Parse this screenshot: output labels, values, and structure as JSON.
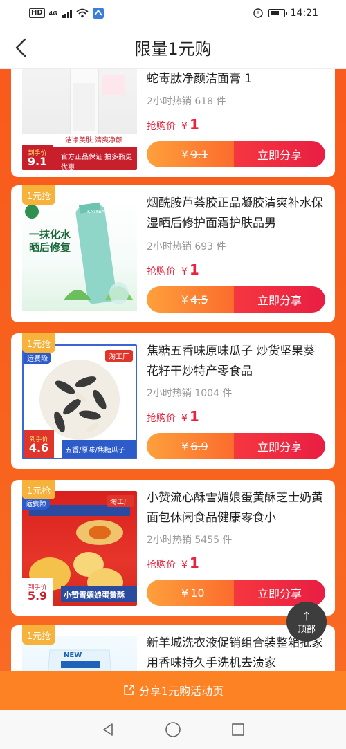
{
  "status_bar": {
    "hd": "HD",
    "network": "4G",
    "time": "14:21"
  },
  "nav": {
    "title": "限量1元购"
  },
  "badge_label": "1元抢",
  "products": [
    {
      "name": "蛇毒肽净颜洁面膏 1",
      "sales": "2小时热销 618 件",
      "price_label": "抢购价",
      "currency": "¥",
      "price": "1",
      "old_price": "9.1",
      "share_label": "立即分享",
      "thumb_text": [
        "洁净美肤 清爽净颜",
        "官方正品保证 拍多瓶更优惠",
        "到手价",
        "9.1"
      ]
    },
    {
      "name": "烟酰胺芦荟胶正品凝胶清爽补水保湿晒后修护面霜护肤品男",
      "sales": "2小时热销 693 件",
      "price_label": "抢购价",
      "currency": "¥",
      "price": "1",
      "old_price": "4.5",
      "share_label": "立即分享",
      "thumb_text": [
        "一抹化水",
        "晒后修复",
        "KNIYEA"
      ]
    },
    {
      "name": "焦糖五香味原味瓜子 炒货坚果葵花籽干炒特产零食品",
      "sales": "2小时热销 1004 件",
      "price_label": "抢购价",
      "currency": "¥",
      "price": "1",
      "old_price": "6.9",
      "share_label": "立即分享",
      "thumb_text": [
        "运费险",
        "淘工厂",
        "五香/原味/焦糖瓜子",
        "到手价",
        "4.6"
      ]
    },
    {
      "name": "小赞流心酥雪媚娘蛋黄酥芝士奶黄面包休闲食品健康零食小",
      "sales": "2小时热销 5455 件",
      "price_label": "抢购价",
      "currency": "¥",
      "price": "1",
      "old_price": "10",
      "share_label": "立即分享",
      "thumb_text": [
        "运费险",
        "淘工厂",
        "小赞雪媚娘蛋黄酥",
        "到手价",
        "5.9"
      ]
    },
    {
      "name": "新羊城洗衣液促销组合装整箱批家用香味持久手洗机去渍家",
      "sales": "",
      "price_label": "",
      "currency": "",
      "price": "",
      "old_price": "",
      "share_label": "",
      "thumb_text": [
        "NEW"
      ]
    }
  ],
  "scroll_top": {
    "label": "顶部"
  },
  "bottom_share": {
    "label": "分享1元购活动页"
  },
  "colors": {
    "bg_orange": "#f95a1d",
    "price_red": "#e8233f",
    "badge_yellow": "#f6b23a",
    "share_red": "#e81e43",
    "bottom_bar": "#fd8224"
  }
}
